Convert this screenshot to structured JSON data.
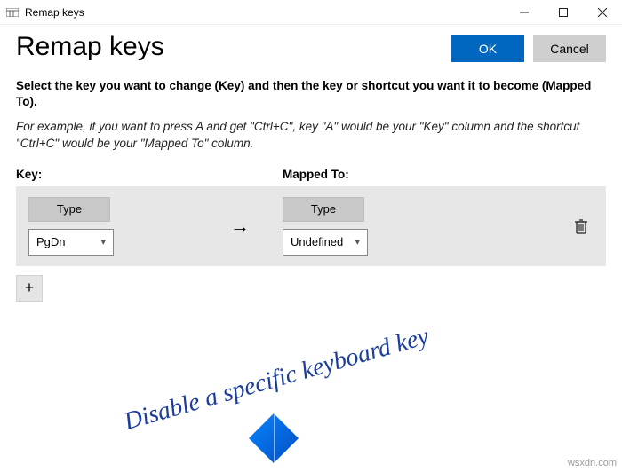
{
  "window": {
    "title": "Remap keys"
  },
  "header": {
    "page_title": "Remap keys",
    "ok_label": "OK",
    "cancel_label": "Cancel"
  },
  "description": {
    "bold": "Select the key you want to change (Key) and then the key or shortcut you want it to become (Mapped To).",
    "italic": "For example, if you want to press A and get \"Ctrl+C\", key \"A\" would be your \"Key\" column and the shortcut \"Ctrl+C\" would be your \"Mapped To\" column."
  },
  "columns": {
    "key_label": "Key:",
    "mapped_label": "Mapped To:"
  },
  "mapping": {
    "key": {
      "type_label": "Type",
      "selected": "PgDn"
    },
    "mapped": {
      "type_label": "Type",
      "selected": "Undefined"
    }
  },
  "add_button": "+",
  "overlay": {
    "caption": "Disable a specific keyboard key"
  },
  "watermark": "wsxdn.com"
}
